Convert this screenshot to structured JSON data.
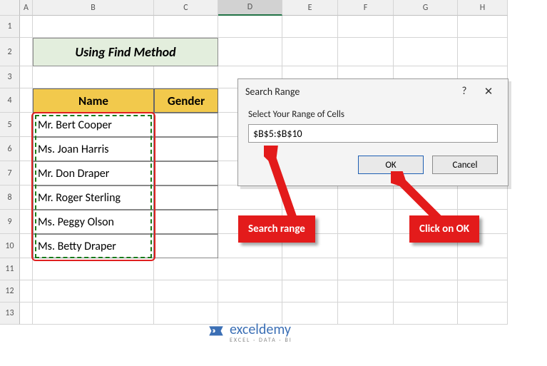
{
  "columns": [
    "A",
    "B",
    "C",
    "D",
    "E",
    "F",
    "G",
    "H"
  ],
  "rows": [
    "1",
    "2",
    "3",
    "4",
    "5",
    "6",
    "7",
    "8",
    "9",
    "10",
    "11",
    "12",
    "13"
  ],
  "active_col": "D",
  "title_cell": "Using Find Method",
  "headers": {
    "name": "Name",
    "gender": "Gender"
  },
  "names": [
    "Mr. Bert Cooper",
    "Ms. Joan Harris",
    "Mr. Don Draper",
    "Mr. Roger Sterling",
    "Ms. Peggy Olson",
    "Ms. Betty Draper"
  ],
  "dialog": {
    "title": "Search Range",
    "prompt": "Select Your Range of Cells",
    "value": "$B$5:$B$10",
    "ok": "OK",
    "cancel": "Cancel"
  },
  "callouts": {
    "range": "Search range",
    "ok": "Click on OK"
  },
  "logo": {
    "brand": "exceldemy",
    "tag": "EXCEL · DATA · BI"
  }
}
